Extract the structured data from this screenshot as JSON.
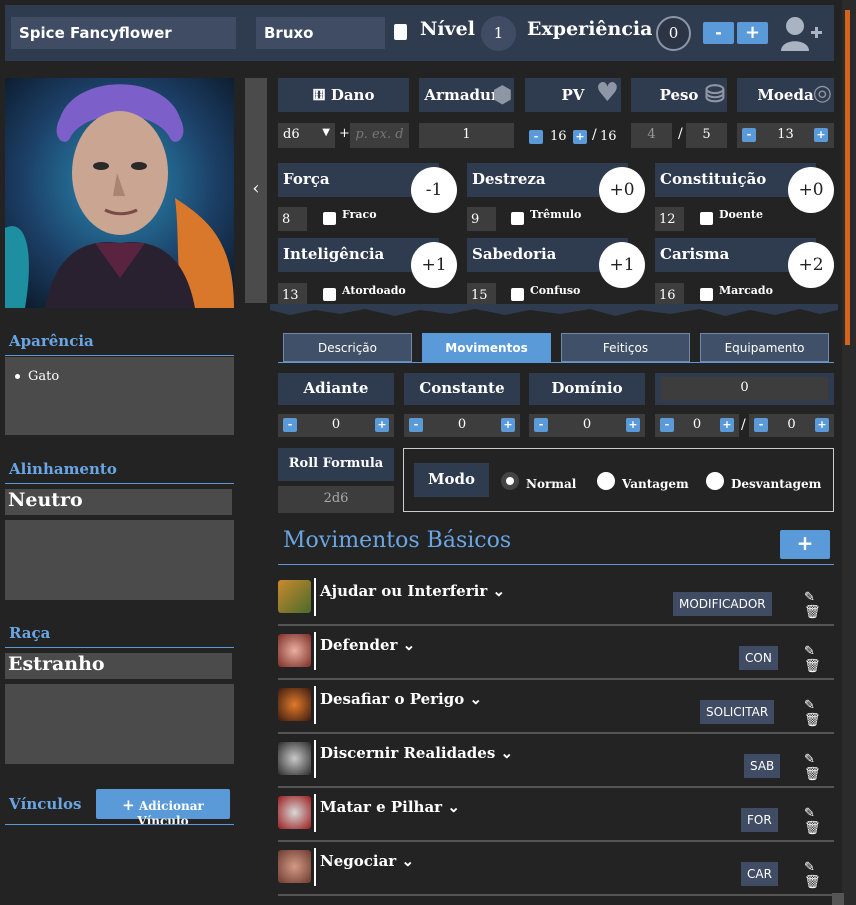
{
  "header": {
    "character_name": "Spice Fancyflower",
    "character_class": "Bruxo",
    "level_label": "Nível",
    "level_value": "1",
    "experience_label": "Experiência",
    "experience_value": "0",
    "minus_label": "-",
    "plus_label": "+"
  },
  "stats": {
    "damage": {
      "label": "Dano",
      "die": "d6",
      "plus_sign": "+",
      "bonus_placeholder": "p. ex. d"
    },
    "armor": {
      "label": "Armadura",
      "value": "1"
    },
    "hp": {
      "label": "PV",
      "current": "16",
      "max": "16",
      "separator": "/"
    },
    "weight": {
      "label": "Peso",
      "current": "4",
      "max": "5",
      "separator": "/"
    },
    "coin": {
      "label": "Moeda",
      "value": "13"
    }
  },
  "attributes": [
    {
      "name": "Força",
      "modifier": "-1",
      "score": "8",
      "debility": "Fraco"
    },
    {
      "name": "Destreza",
      "modifier": "+0",
      "score": "9",
      "debility": "Trêmulo"
    },
    {
      "name": "Constituição",
      "modifier": "+0",
      "score": "12",
      "debility": "Doente"
    },
    {
      "name": "Inteligência",
      "modifier": "+1",
      "score": "13",
      "debility": "Atordoado"
    },
    {
      "name": "Sabedoria",
      "modifier": "+1",
      "score": "15",
      "debility": "Confuso"
    },
    {
      "name": "Carisma",
      "modifier": "+2",
      "score": "16",
      "debility": "Marcado"
    }
  ],
  "left": {
    "appearance_title": "Aparência",
    "appearance_items": [
      "Gato"
    ],
    "alignment_title": "Alinhamento",
    "alignment_value": "Neutro",
    "race_title": "Raça",
    "race_value": "Estranho",
    "bonds_title": "Vínculos",
    "add_bond_label": "Adicionar Vínculo"
  },
  "tabs": [
    "Descrição",
    "Movimentos",
    "Feitiços",
    "Equipamento"
  ],
  "active_tab": "Movimentos",
  "counters": {
    "forward": {
      "label": "Adiante",
      "value": "0"
    },
    "ongoing": {
      "label": "Constante",
      "value": "0"
    },
    "hold": {
      "label": "Domínio",
      "value": "0"
    },
    "result": {
      "value": "0"
    },
    "extra_a": "0",
    "extra_b": "0",
    "extra_separator": "/"
  },
  "roll": {
    "formula_label": "Roll Formula",
    "formula_value": "2d6",
    "mode_label": "Modo",
    "modes": [
      "Normal",
      "Vantagem",
      "Desvantagem"
    ],
    "selected_mode": "Normal"
  },
  "basic_moves": {
    "title": "Movimentos Básicos",
    "add_label": "+",
    "moves": [
      {
        "name": "Ajudar ou Interferir",
        "tag": "MODIFICADOR"
      },
      {
        "name": "Defender",
        "tag": "CON"
      },
      {
        "name": "Desafiar o Perigo",
        "tag": "SOLICITAR"
      },
      {
        "name": "Discernir Realidades",
        "tag": "SAB"
      },
      {
        "name": "Matar e Pilhar",
        "tag": "FOR"
      },
      {
        "name": "Negociar",
        "tag": "CAR"
      }
    ]
  },
  "colors": {
    "accent": "#5b9ad9",
    "header_bg": "#2f3b4f",
    "page_bg": "#232323",
    "scroll_thumb": "#d4631c"
  }
}
